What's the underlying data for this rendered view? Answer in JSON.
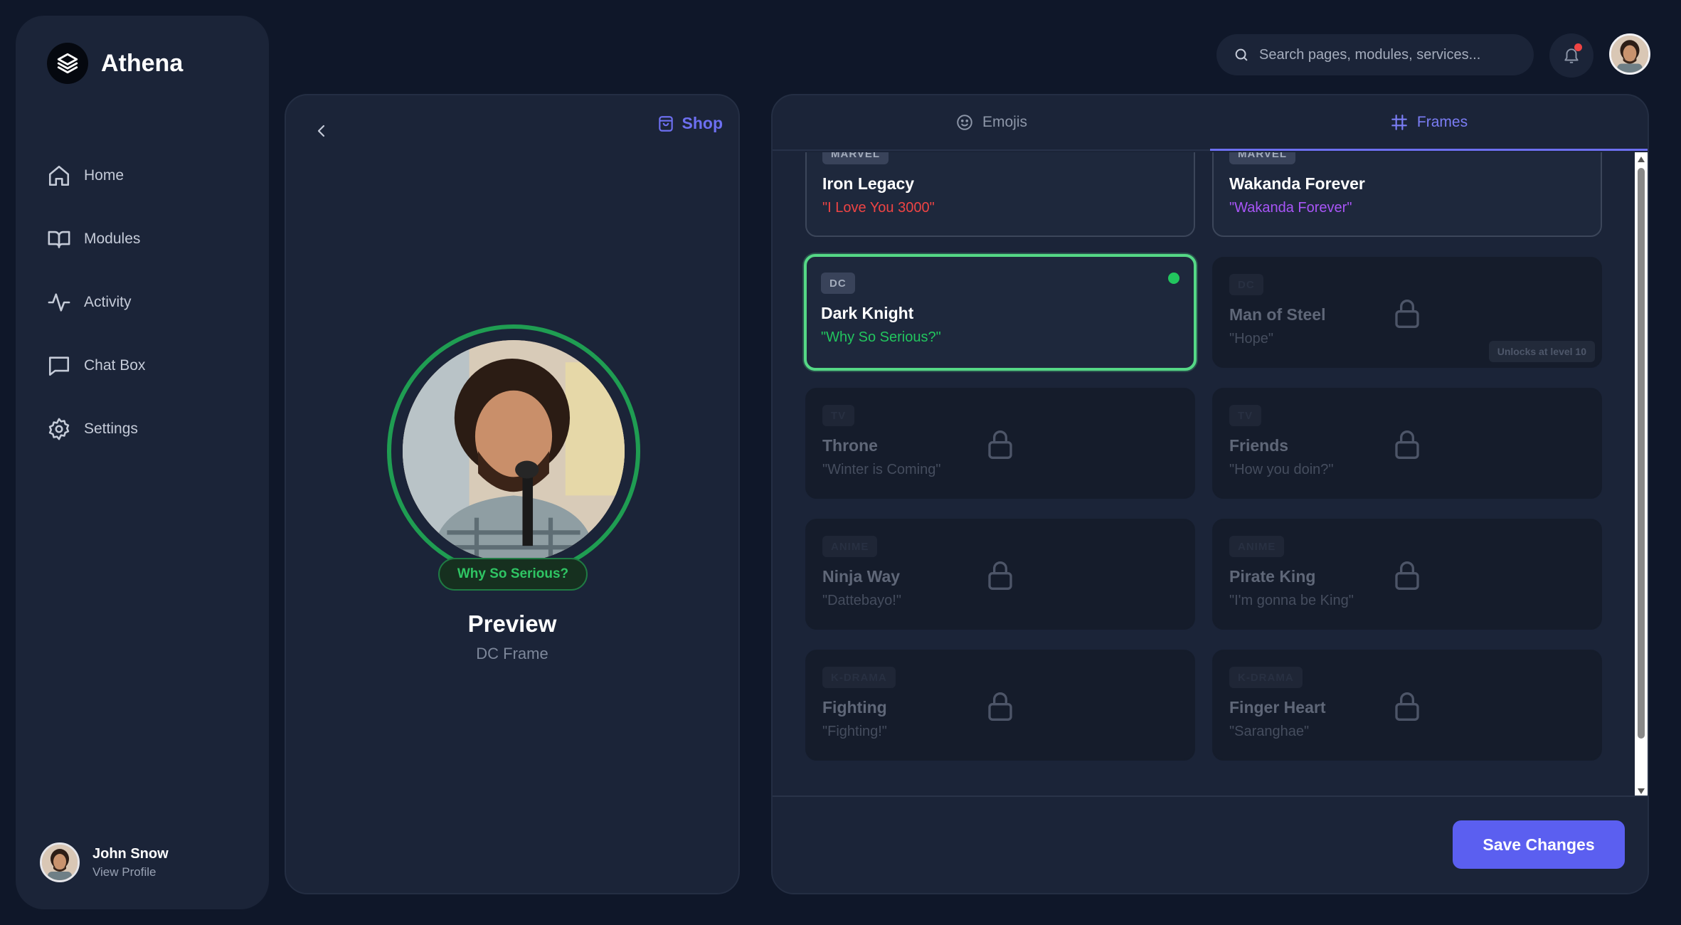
{
  "app": {
    "name": "Athena"
  },
  "sidebar": {
    "items": [
      {
        "label": "Home",
        "icon": "home-icon"
      },
      {
        "label": "Modules",
        "icon": "book-icon"
      },
      {
        "label": "Activity",
        "icon": "activity-icon"
      },
      {
        "label": "Chat Box",
        "icon": "chat-icon"
      },
      {
        "label": "Settings",
        "icon": "gear-icon"
      }
    ],
    "profile": {
      "name": "John Snow",
      "link": "View Profile"
    }
  },
  "topbar": {
    "search_placeholder": "Search pages, modules, services...",
    "has_notification": true
  },
  "preview": {
    "shop_label": "Shop",
    "frame_quote": "Why So Serious?",
    "title": "Preview",
    "subtitle": "DC Frame",
    "frame_color": "#1f9d52"
  },
  "tabs": [
    {
      "label": "Emojis",
      "icon": "smile-icon",
      "active": false
    },
    {
      "label": "Frames",
      "icon": "hash-icon",
      "active": true
    }
  ],
  "frames": [
    {
      "tag": "MARVEL",
      "title": "Iron Legacy",
      "quote": "\"I Love You 3000\"",
      "quote_color": "#ef4444",
      "state": "unlocked"
    },
    {
      "tag": "MARVEL",
      "title": "Wakanda Forever",
      "quote": "\"Wakanda Forever\"",
      "quote_color": "#a855f7",
      "state": "unlocked"
    },
    {
      "tag": "DC",
      "title": "Dark Knight",
      "quote": "\"Why So Serious?\"",
      "quote_color": "#22c55e",
      "state": "selected"
    },
    {
      "tag": "DC",
      "title": "Man of Steel",
      "quote": "\"Hope\"",
      "state": "locked",
      "unlock_note": "Unlocks at level 10"
    },
    {
      "tag": "TV",
      "title": "Throne",
      "quote": "\"Winter is Coming\"",
      "state": "locked"
    },
    {
      "tag": "TV",
      "title": "Friends",
      "quote": "\"How you doin?\"",
      "state": "locked"
    },
    {
      "tag": "ANIME",
      "title": "Ninja Way",
      "quote": "\"Dattebayo!\"",
      "state": "locked"
    },
    {
      "tag": "ANIME",
      "title": "Pirate King",
      "quote": "\"I'm gonna be King\"",
      "state": "locked"
    },
    {
      "tag": "K-DRAMA",
      "title": "Fighting",
      "quote": "\"Fighting!\"",
      "state": "locked"
    },
    {
      "tag": "K-DRAMA",
      "title": "Finger Heart",
      "quote": "\"Saranghae\"",
      "state": "locked"
    }
  ],
  "footer": {
    "save_label": "Save Changes"
  },
  "colors": {
    "accent": "#5b5ff0",
    "selected": "#55d886",
    "background": "#0f1729",
    "panel": "#1b2438"
  }
}
